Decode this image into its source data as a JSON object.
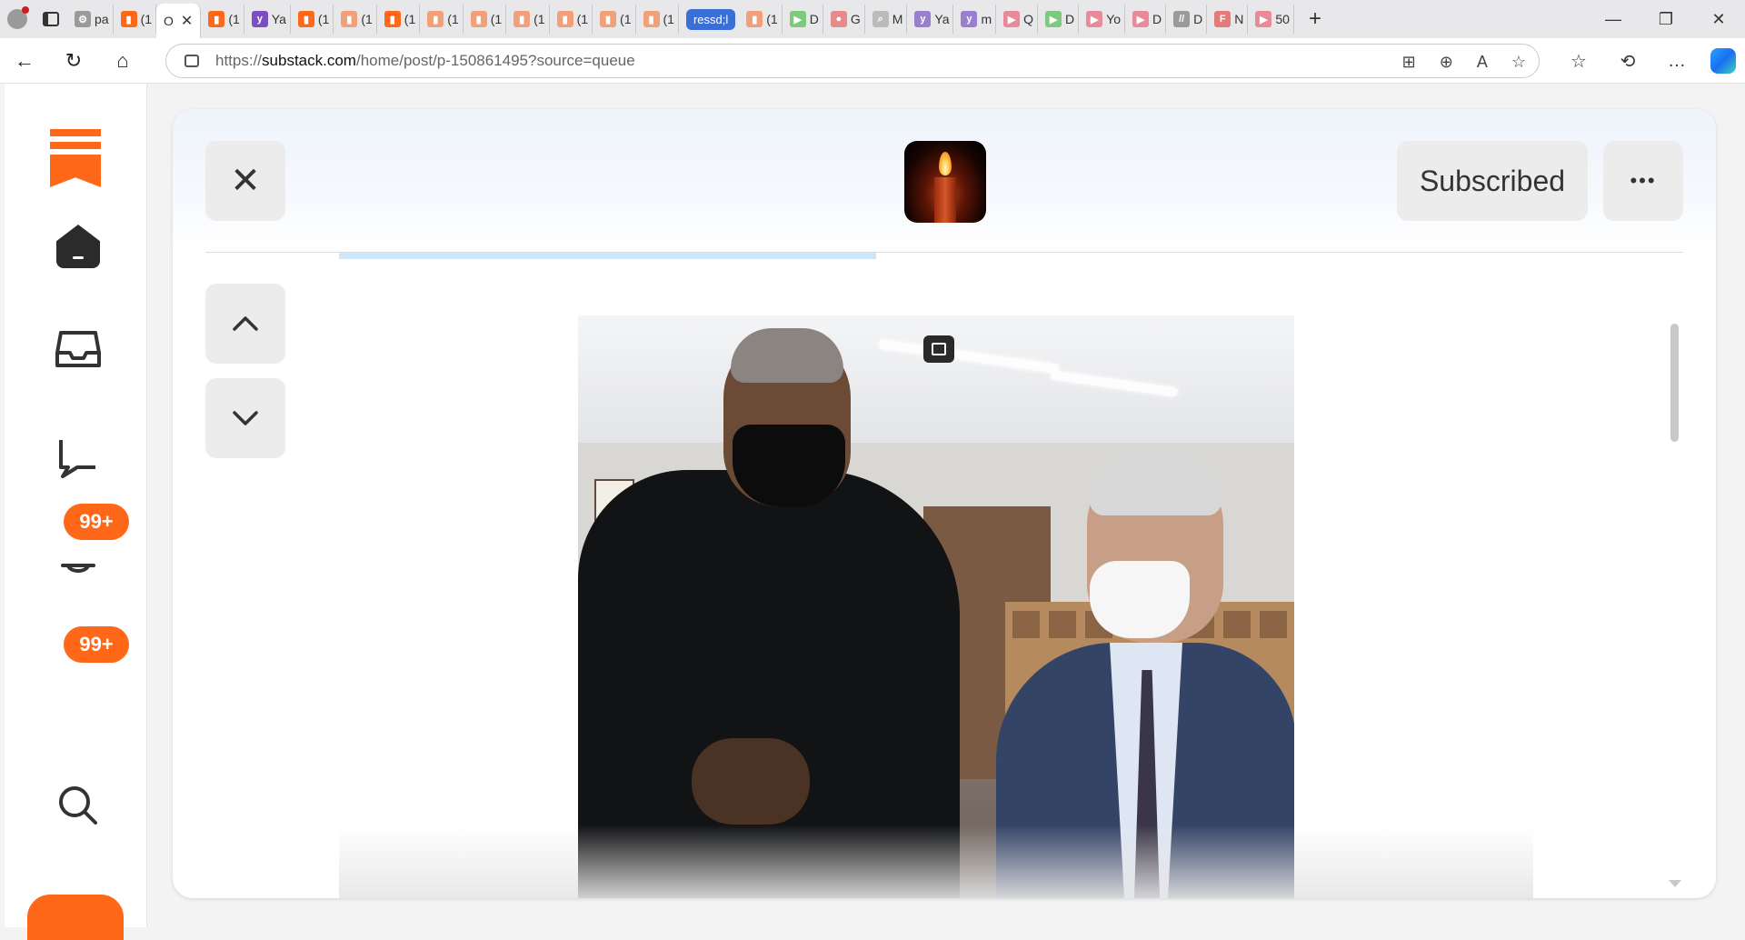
{
  "browser": {
    "tabs": [
      {
        "label": "pa",
        "fav_color": "#9a9a9a",
        "fav_glyph": "⚙"
      },
      {
        "label": "(1",
        "fav_color": "#ff6719",
        "fav_glyph": "▮"
      },
      {
        "label": "O",
        "fav_color": "",
        "fav_glyph": "",
        "active": true
      },
      {
        "label": "(1",
        "fav_color": "#ff6719",
        "fav_glyph": "▮"
      },
      {
        "label": "Ya",
        "fav_color": "#7b4fbf",
        "fav_glyph": "y"
      },
      {
        "label": "(1",
        "fav_color": "#ff6719",
        "fav_glyph": "▮"
      },
      {
        "label": "(1",
        "fav_color": "#f2a07a",
        "fav_glyph": "▮"
      },
      {
        "label": "(1",
        "fav_color": "#ff6719",
        "fav_glyph": "▮"
      },
      {
        "label": "(1",
        "fav_color": "#f2a07a",
        "fav_glyph": "▮"
      },
      {
        "label": "(1",
        "fav_color": "#f2a07a",
        "fav_glyph": "▮"
      },
      {
        "label": "(1",
        "fav_color": "#f2a07a",
        "fav_glyph": "▮"
      },
      {
        "label": "(1",
        "fav_color": "#f2a07a",
        "fav_glyph": "▮"
      },
      {
        "label": "(1",
        "fav_color": "#f2a07a",
        "fav_glyph": "▮"
      },
      {
        "label": "(1",
        "fav_color": "#f2a07a",
        "fav_glyph": "▮"
      },
      {
        "label": "ressd;l",
        "fav_color": "",
        "fav_glyph": "",
        "pill": true
      },
      {
        "label": "(1",
        "fav_color": "#f2a07a",
        "fav_glyph": "▮"
      },
      {
        "label": "D",
        "fav_color": "#7dc97d",
        "fav_glyph": "▶"
      },
      {
        "label": "G",
        "fav_color": "#e88a8a",
        "fav_glyph": "●"
      },
      {
        "label": "M",
        "fav_color": "#bbbbbb",
        "fav_glyph": "⌕"
      },
      {
        "label": "Ya",
        "fav_color": "#9b7fcf",
        "fav_glyph": "y"
      },
      {
        "label": "m",
        "fav_color": "#9b7fcf",
        "fav_glyph": "y"
      },
      {
        "label": "Q",
        "fav_color": "#e88a9a",
        "fav_glyph": "▶"
      },
      {
        "label": "D",
        "fav_color": "#7dc97d",
        "fav_glyph": "▶"
      },
      {
        "label": "Yo",
        "fav_color": "#e88a9a",
        "fav_glyph": "▶"
      },
      {
        "label": "D",
        "fav_color": "#e88a9a",
        "fav_glyph": "▶"
      },
      {
        "label": "D",
        "fav_color": "#9a9a9a",
        "fav_glyph": "//"
      },
      {
        "label": "N",
        "fav_color": "#e57a7a",
        "fav_glyph": "F"
      },
      {
        "label": "50",
        "fav_color": "#e88a9a",
        "fav_glyph": "▶"
      }
    ],
    "new_tab": "+",
    "window_controls": {
      "minimize": "—",
      "restore": "❐",
      "close": "✕"
    },
    "address": {
      "prefix": "https://",
      "domain": "substack.com",
      "path": "/home/post/p-150861495?source=queue"
    },
    "nav": {
      "back": "←",
      "reload": "↻",
      "home": "⌂"
    },
    "omni_icons": [
      "⊞",
      "⊕",
      "A",
      "☆"
    ],
    "toolbar_icons": [
      "☆",
      "⟲",
      "…"
    ]
  },
  "rail": {
    "chat_badge": "99+",
    "notifications_badge": "99+"
  },
  "post": {
    "subscribe_label": "Subscribed",
    "more_label": "•••",
    "close_glyph": "✕",
    "prev_glyph": "⌃",
    "next_glyph": "⌄",
    "read_progress": 0.45
  },
  "colors": {
    "brand": "#ff6719",
    "pill_tab": "#3a6fd8"
  }
}
